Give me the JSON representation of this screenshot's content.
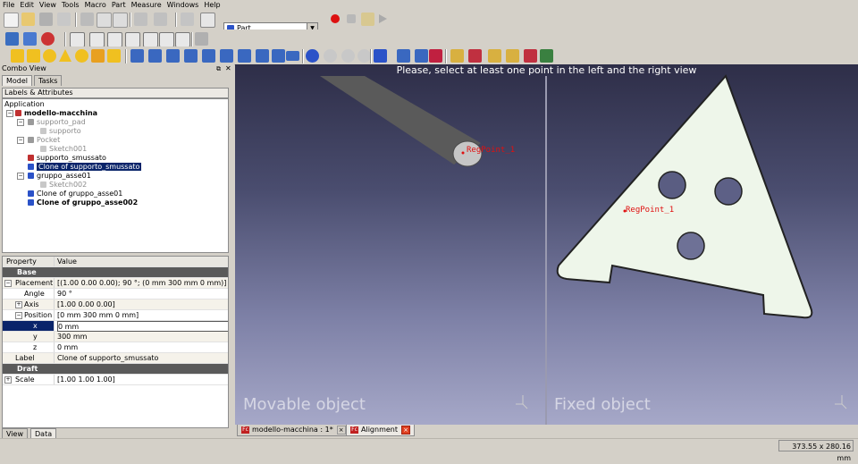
{
  "menubar": {
    "items": [
      "File",
      "Edit",
      "View",
      "Tools",
      "Macro",
      "Part",
      "Measure",
      "Windows",
      "Help"
    ]
  },
  "workbench": {
    "selected": "Part"
  },
  "combo_view": {
    "title": "Combo View",
    "tabs": [
      "Model",
      "Tasks"
    ],
    "subtab": "Labels & Attributes",
    "tree": {
      "root": "Application",
      "items": [
        "modello-macchina",
        "supporto_pad",
        "supporto",
        "Pocket",
        "Sketch001",
        "supporto_smussato",
        "Clone of supporto_smussato",
        "gruppo_asse01",
        "Sketch002",
        "Clone of gruppo_asse01",
        "Clone of gruppo_asse002"
      ]
    },
    "properties": {
      "headers": [
        "Property",
        "Value"
      ],
      "group_base": "Base",
      "group_draft": "Draft",
      "rows": [
        {
          "name": "Placement",
          "value": "[(1.00 0.00 0.00); 90 °; (0 mm  300 mm  0 mm)]"
        },
        {
          "name": "Angle",
          "value": "90 °"
        },
        {
          "name": "Axis",
          "value": "[1.00 0.00 0.00]"
        },
        {
          "name": "Position",
          "value": "[0 mm  300 mm  0 mm]"
        },
        {
          "name": "x",
          "value": "0 mm"
        },
        {
          "name": "y",
          "value": "300 mm"
        },
        {
          "name": "z",
          "value": "0 mm"
        },
        {
          "name": "Label",
          "value": "Clone of supporto_smussato"
        },
        {
          "name": "Scale",
          "value": "[1.00 1.00 1.00]"
        }
      ]
    },
    "bottom_tabs": [
      "View",
      "Data"
    ]
  },
  "viewport": {
    "message": "Please, select at least one point in the left and the right view",
    "left_label": "Movable object",
    "right_label": "Fixed object",
    "left_point": "RegPoint_1",
    "right_point": "RegPoint_1"
  },
  "doc_tabs": [
    "modello-macchina : 1*",
    "Alignment"
  ],
  "status": {
    "coordinates": "373.55 x 280.16 mm"
  },
  "colors": {
    "selection": "#0a246a",
    "record": "#dd1111",
    "part_blue": "#2b52c8"
  }
}
